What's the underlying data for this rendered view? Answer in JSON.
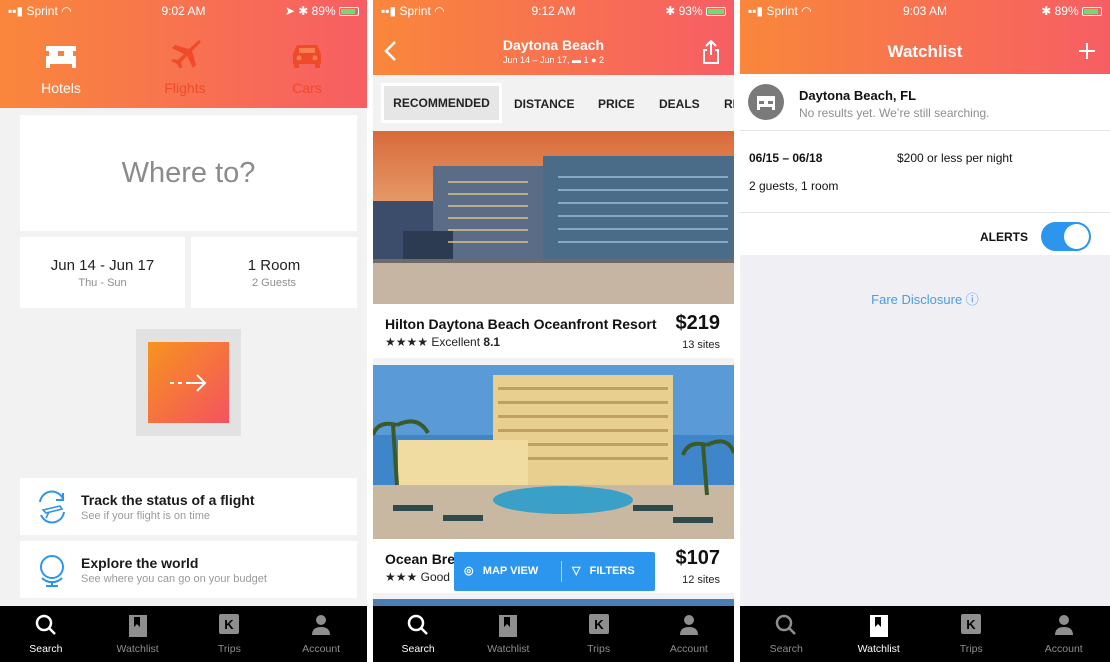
{
  "colors": {
    "accent_start": "#f9873b",
    "accent_end": "#f75e64",
    "blue": "#2c95ee",
    "tabbar": "#000000"
  },
  "screen1": {
    "status": {
      "carrier": "Sprint",
      "time": "9:02 AM",
      "battery": "89%"
    },
    "header_tabs": [
      {
        "label": "Hotels",
        "icon": "bed-icon"
      },
      {
        "label": "Flights",
        "icon": "plane-icon"
      },
      {
        "label": "Cars",
        "icon": "car-icon"
      }
    ],
    "destination_placeholder": "Where to?",
    "dates": {
      "range": "Jun 14 - Jun 17",
      "days": "Thu - Sun"
    },
    "rooms": {
      "count": "1 Room",
      "guests": "2 Guests"
    },
    "features": [
      {
        "title": "Track the status of a flight",
        "subtitle": "See if your flight is on time",
        "icon": "flight-status-icon"
      },
      {
        "title": "Explore the world",
        "subtitle": "See where you can go on your budget",
        "icon": "globe-icon"
      }
    ]
  },
  "screen2": {
    "status": {
      "carrier": "Sprint",
      "time": "9:12 AM",
      "battery": "93%"
    },
    "title": "Daytona Beach",
    "subtitle": "Jun 14 – Jun 17,",
    "rooms": "1",
    "guests": "2",
    "sort_options": [
      "RECOMMENDED",
      "DISTANCE",
      "PRICE",
      "DEALS",
      "RI"
    ],
    "hotels": [
      {
        "name": "Hilton Daytona Beach Oceanfront Resort",
        "stars": "★★★★",
        "rating_label": "Excellent",
        "rating": "8.1",
        "price": "$219",
        "sites": "13 sites"
      },
      {
        "name": "Ocean Bre",
        "stars": "★★★",
        "rating_label": "Good",
        "price": "$107",
        "sites": "12 sites"
      }
    ],
    "map_view": "MAP VIEW",
    "filters": "FILTERS"
  },
  "screen3": {
    "status": {
      "carrier": "Sprint",
      "time": "9:03 AM",
      "battery": "89%"
    },
    "title": "Watchlist",
    "item": {
      "place": "Daytona Beach, FL",
      "status": "No results yet. We’re still searching.",
      "dates": "06/15 – 06/18",
      "price": "$200 or less per night",
      "party": "2 guests, 1 room"
    },
    "alerts_label": "ALERTS",
    "alerts_on": true,
    "fare_disclosure": "Fare Disclosure ⓘ"
  },
  "tabbar": [
    "Search",
    "Watchlist",
    "Trips",
    "Account"
  ]
}
